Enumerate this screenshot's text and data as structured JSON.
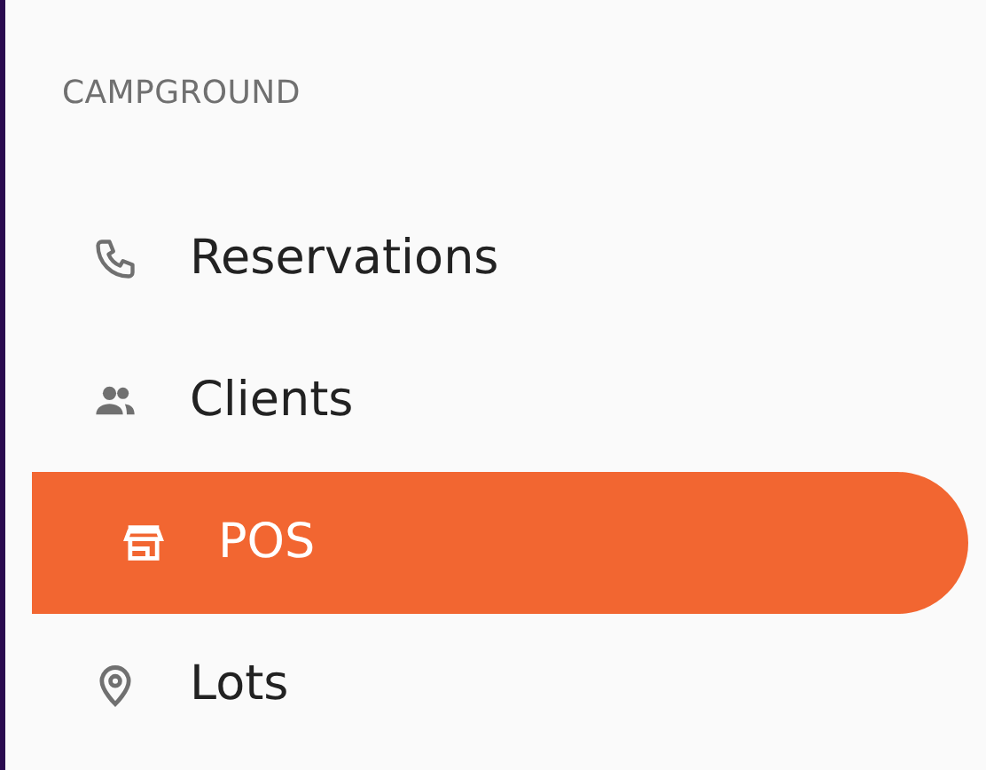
{
  "section": {
    "title": "CAMPGROUND"
  },
  "items": [
    {
      "label": "Reservations",
      "selected": false
    },
    {
      "label": "Clients",
      "selected": false
    },
    {
      "label": "POS",
      "selected": true
    },
    {
      "label": "Lots",
      "selected": false
    }
  ]
}
